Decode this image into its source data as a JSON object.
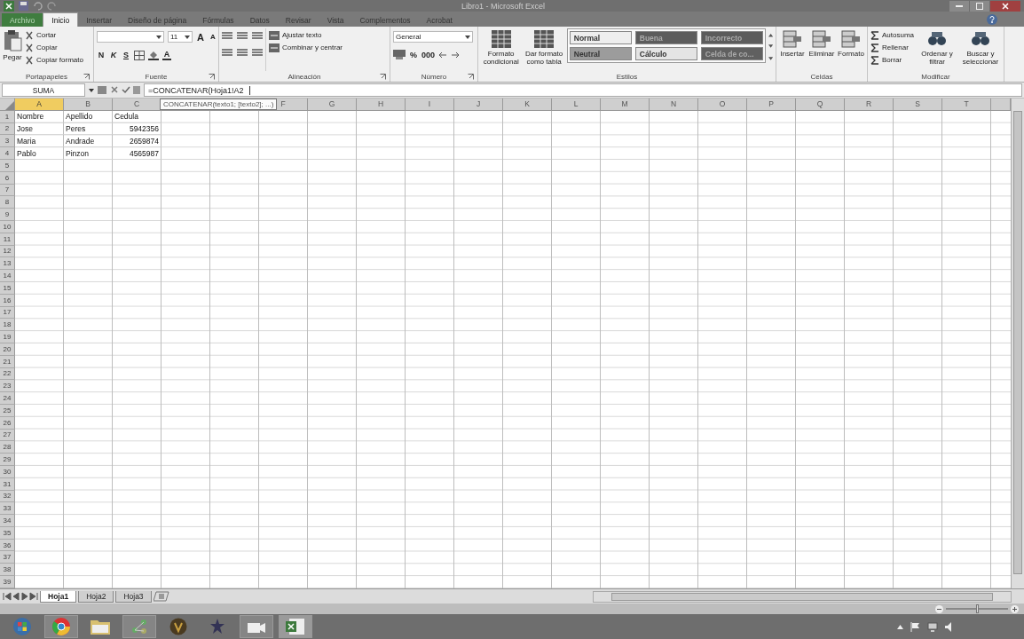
{
  "window": {
    "title": "Libro1 - Microsoft Excel"
  },
  "tabs": [
    {
      "label": "Archivo",
      "kind": "file",
      "selected": false
    },
    {
      "label": "Inicio",
      "kind": "tab",
      "selected": true
    },
    {
      "label": "Insertar",
      "kind": "tab",
      "selected": false
    },
    {
      "label": "Diseño de página",
      "kind": "tab",
      "selected": false
    },
    {
      "label": "Fórmulas",
      "kind": "tab",
      "selected": false
    },
    {
      "label": "Datos",
      "kind": "tab",
      "selected": false
    },
    {
      "label": "Revisar",
      "kind": "tab",
      "selected": false
    },
    {
      "label": "Vista",
      "kind": "tab",
      "selected": false
    },
    {
      "label": "Complementos",
      "kind": "tab",
      "selected": false
    },
    {
      "label": "Acrobat",
      "kind": "tab",
      "selected": false
    }
  ],
  "ribbon": {
    "groups": [
      {
        "kind": "clipboard",
        "label": "Portapapeles",
        "large": "Pegar",
        "small": [
          "Cortar",
          "Copiar",
          "Copiar formato"
        ]
      },
      {
        "kind": "font",
        "label": "Fuente",
        "font_size": "11",
        "size_buttons": [
          "A",
          "A"
        ],
        "buttons": [
          "N",
          "K",
          "S"
        ],
        "color_button": "A"
      },
      {
        "kind": "alignment",
        "label": "Alineación",
        "buttons": [
          "Ajustar texto",
          "Combinar y centrar"
        ]
      },
      {
        "kind": "number",
        "label": "Número",
        "format": "General",
        "buttons": [
          "%",
          "000"
        ]
      },
      {
        "kind": "styles",
        "label": "Estilos",
        "large": [
          "Formato condicional",
          "Dar formato como tabla"
        ],
        "styles": [
          {
            "label": "Normal",
            "color": "#eeeeee"
          },
          {
            "label": "Buena",
            "color": "#5c5c5c"
          },
          {
            "label": "Incorrecto",
            "color": "#5c5c5c"
          },
          {
            "label": "Neutral",
            "color": "#9c9c9c"
          },
          {
            "label": "Cálculo",
            "color": "#e4e4e4"
          },
          {
            "label": "Celda de co...",
            "color": "#606060"
          }
        ]
      },
      {
        "kind": "cells",
        "label": "Celdas",
        "large": [
          "Insertar",
          "Eliminar",
          "Formato"
        ]
      },
      {
        "kind": "editing",
        "label": "Modificar",
        "small": [
          "Autosuma",
          "Rellenar",
          "Borrar"
        ],
        "large": [
          "Ordenar y filtrar",
          "Buscar y seleccionar"
        ]
      }
    ]
  },
  "formula_bar": {
    "name_box": "SUMA",
    "formula": "=CONCATENAR(Hoja1!A2",
    "tooltip": "CONCATENAR(texto1; [texto2]; ...)"
  },
  "sheet": {
    "columns": [
      {
        "label": "A",
        "selected": true
      },
      {
        "label": "B",
        "selected": false
      },
      {
        "label": "C",
        "selected": false
      },
      {
        "label": "F",
        "selected": false
      },
      {
        "label": "G",
        "selected": false
      },
      {
        "label": "H",
        "selected": false
      },
      {
        "label": "I",
        "selected": false
      },
      {
        "label": "J",
        "selected": false
      },
      {
        "label": "K",
        "selected": false
      },
      {
        "label": "L",
        "selected": false
      },
      {
        "label": "M",
        "selected": false
      },
      {
        "label": "N",
        "selected": false
      },
      {
        "label": "O",
        "selected": false
      },
      {
        "label": "P",
        "selected": false
      },
      {
        "label": "Q",
        "selected": false
      },
      {
        "label": "R",
        "selected": false
      },
      {
        "label": "S",
        "selected": false
      },
      {
        "label": "T",
        "selected": false
      }
    ],
    "rows": [
      {
        "label": "1",
        "cells": [
          {
            "text": "Nombre",
            "kind": "text"
          },
          {
            "text": "Apellido",
            "kind": "text"
          },
          {
            "text": "Cedula",
            "kind": "text"
          }
        ]
      },
      {
        "label": "2",
        "cells": [
          {
            "text": "Jose",
            "kind": "text"
          },
          {
            "text": "Peres",
            "kind": "text"
          },
          {
            "text": "5942356",
            "kind": "number"
          }
        ]
      },
      {
        "label": "3",
        "cells": [
          {
            "text": "Maria",
            "kind": "text"
          },
          {
            "text": "Andrade",
            "kind": "text"
          },
          {
            "text": "2659874",
            "kind": "number"
          }
        ]
      },
      {
        "label": "4",
        "cells": [
          {
            "text": "Pablo",
            "kind": "text"
          },
          {
            "text": "Pinzon",
            "kind": "text"
          },
          {
            "text": "4565987",
            "kind": "number"
          }
        ]
      },
      {
        "label": "5"
      },
      {
        "label": "6"
      },
      {
        "label": "7"
      },
      {
        "label": "8"
      },
      {
        "label": "9"
      },
      {
        "label": "10"
      },
      {
        "label": "11"
      },
      {
        "label": "12"
      },
      {
        "label": "13"
      },
      {
        "label": "14"
      },
      {
        "label": "15"
      },
      {
        "label": "16"
      },
      {
        "label": "17"
      },
      {
        "label": "18"
      },
      {
        "label": "19"
      },
      {
        "label": "20"
      },
      {
        "label": "21"
      },
      {
        "label": "22"
      },
      {
        "label": "23"
      },
      {
        "label": "24"
      },
      {
        "label": "25"
      },
      {
        "label": "26"
      },
      {
        "label": "27"
      },
      {
        "label": "28"
      },
      {
        "label": "29"
      },
      {
        "label": "30"
      },
      {
        "label": "31"
      },
      {
        "label": "32"
      },
      {
        "label": "33"
      },
      {
        "label": "34"
      },
      {
        "label": "35"
      },
      {
        "label": "36"
      },
      {
        "label": "37"
      },
      {
        "label": "38"
      },
      {
        "label": "39"
      }
    ]
  },
  "zoom": {
    "level": 0.5
  },
  "sheet_tabs": [
    {
      "label": "Hoja1",
      "selected": true
    },
    {
      "label": "Hoja2",
      "selected": false
    },
    {
      "label": "Hoja3",
      "selected": false
    }
  ]
}
